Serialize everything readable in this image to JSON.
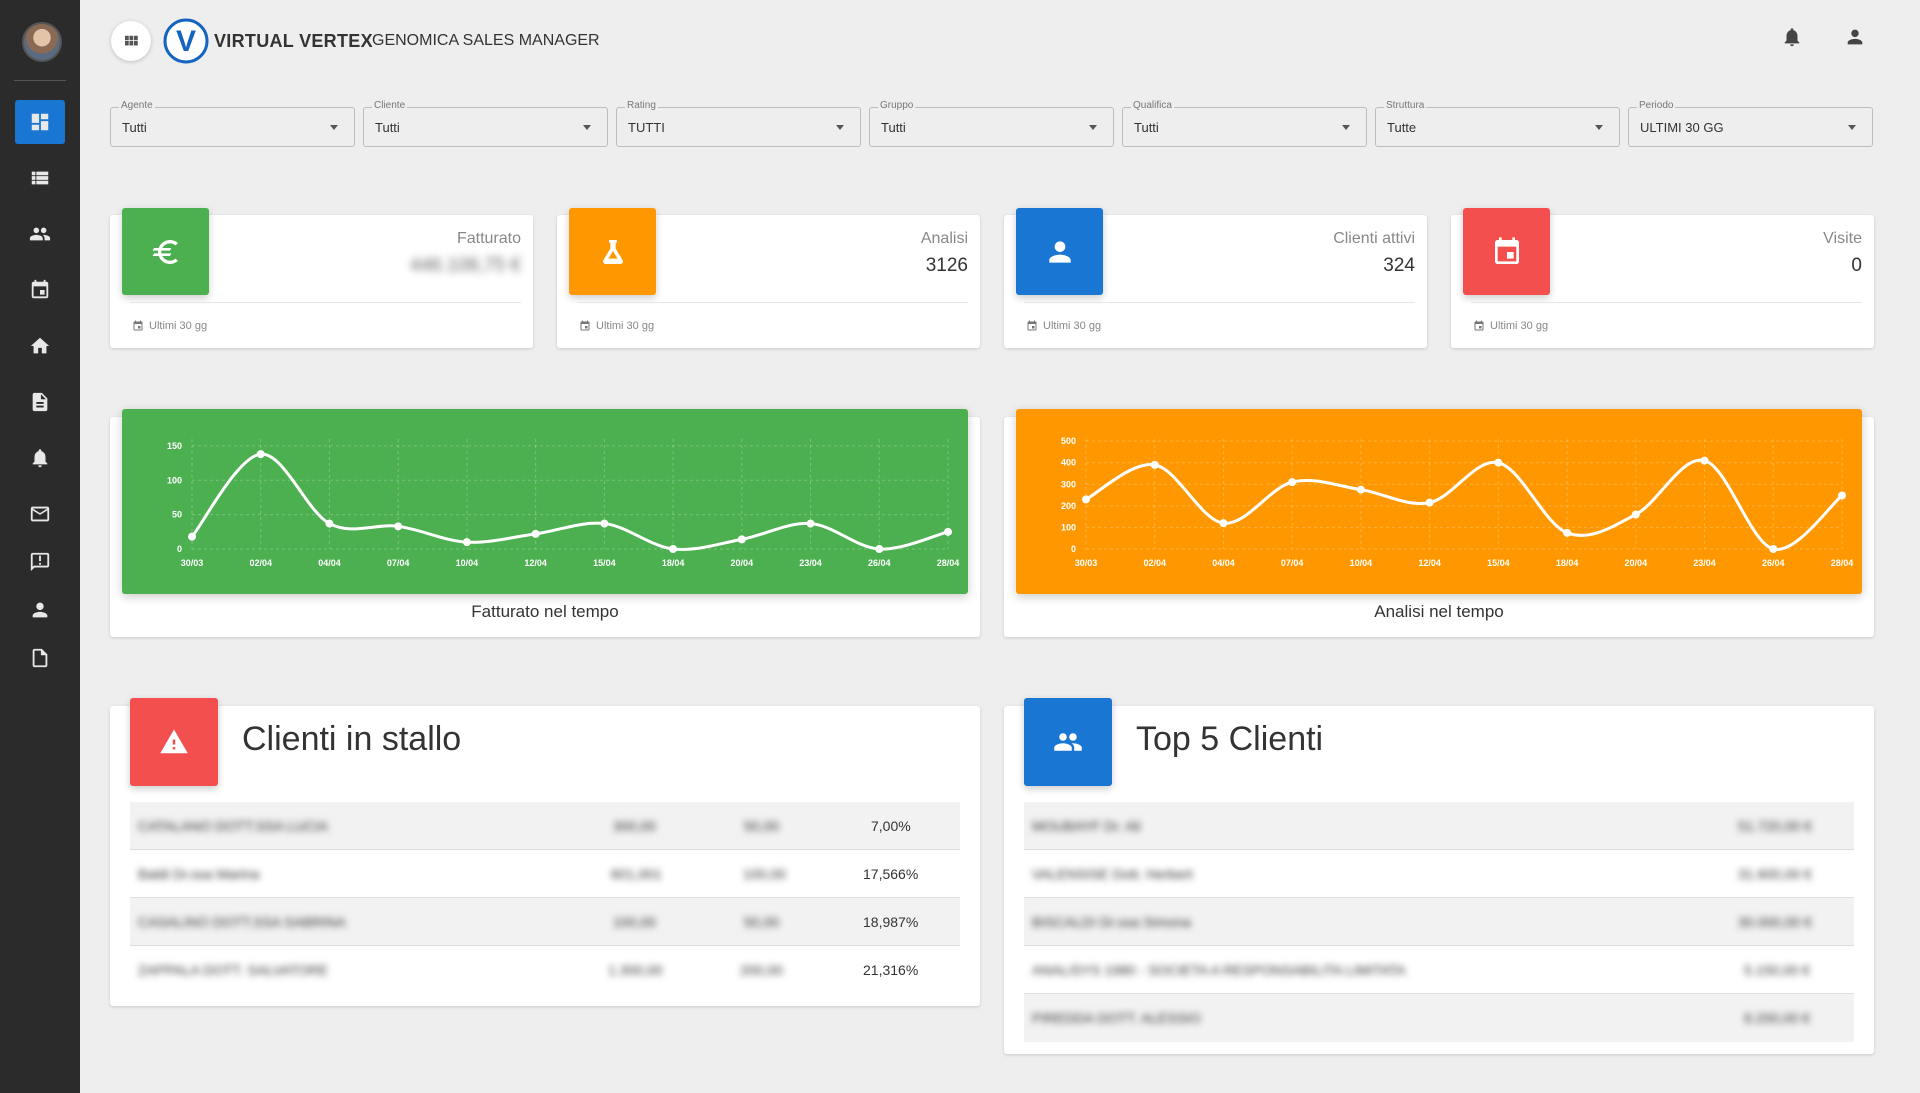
{
  "header": {
    "brand": "VIRTUAL VERTEX",
    "app_title": "GENOMICA SALES MANAGER",
    "logo_letter": "V"
  },
  "sidebar": {
    "items": [
      {
        "name": "dashboard",
        "icon": "dashboard-icon",
        "active": true
      },
      {
        "name": "list",
        "icon": "list-icon"
      },
      {
        "name": "clients",
        "icon": "people-icon"
      },
      {
        "name": "calendar",
        "icon": "calendar-icon"
      },
      {
        "name": "home",
        "icon": "home-icon"
      },
      {
        "name": "documents",
        "icon": "document-icon"
      },
      {
        "name": "notifications",
        "icon": "bell-icon"
      },
      {
        "name": "mail",
        "icon": "mail-icon"
      },
      {
        "name": "feedback",
        "icon": "feedback-icon"
      },
      {
        "name": "user",
        "icon": "person-icon"
      },
      {
        "name": "file",
        "icon": "file-icon"
      }
    ]
  },
  "filters": [
    {
      "label": "Agente",
      "value": "Tutti"
    },
    {
      "label": "Cliente",
      "value": "Tutti"
    },
    {
      "label": "Rating",
      "value": "TUTTI"
    },
    {
      "label": "Gruppo",
      "value": "Tutti"
    },
    {
      "label": "Qualifica",
      "value": "Tutti"
    },
    {
      "label": "Struttura",
      "value": "Tutte"
    },
    {
      "label": "Periodo",
      "value": "ULTIMI 30 GG"
    }
  ],
  "stats": [
    {
      "label": "Fatturato",
      "value": "446.108,75 €",
      "footer": "Ultimi 30 gg",
      "color": "#4caf50",
      "icon": "euro-icon"
    },
    {
      "label": "Analisi",
      "value": "3126",
      "footer": "Ultimi 30 gg",
      "color": "#ff9800",
      "icon": "flask-icon"
    },
    {
      "label": "Clienti attivi",
      "value": "324",
      "footer": "Ultimi 30 gg",
      "color": "#1976d2",
      "icon": "person-icon"
    },
    {
      "label": "Visite",
      "value": "0",
      "footer": "Ultimi 30 gg",
      "color": "#f44f4f",
      "icon": "calendar-icon"
    }
  ],
  "chart_data": [
    {
      "type": "line",
      "title": "Fatturato nel tempo",
      "color": "#4caf50",
      "categories": [
        "30/03",
        "02/04",
        "04/04",
        "07/04",
        "10/04",
        "12/04",
        "15/04",
        "18/04",
        "20/04",
        "23/04",
        "26/04",
        "28/04"
      ],
      "values": [
        18,
        138,
        37,
        33,
        10,
        22,
        37,
        0,
        14,
        37,
        0,
        25
      ],
      "yticks": [
        0,
        50,
        100,
        150
      ],
      "ylim": [
        0,
        160
      ],
      "grid": true
    },
    {
      "type": "line",
      "title": "Analisi nel tempo",
      "color": "#ff9800",
      "categories": [
        "30/03",
        "02/04",
        "04/04",
        "07/04",
        "10/04",
        "12/04",
        "15/04",
        "18/04",
        "20/04",
        "23/04",
        "26/04",
        "28/04"
      ],
      "values": [
        230,
        390,
        120,
        310,
        275,
        215,
        400,
        75,
        160,
        410,
        0,
        248
      ],
      "yticks": [
        0,
        100,
        200,
        300,
        400,
        500
      ],
      "ylim": [
        0,
        510
      ],
      "grid": true
    }
  ],
  "stalled": {
    "title": "Clienti in stallo",
    "color": "#f44f4f",
    "rows": [
      {
        "name": "CATALANO DOTT.SSA LUCIA",
        "a": "300,00",
        "b": "50,00",
        "pct": "7,00%"
      },
      {
        "name": "Baldi Dr.ssa Marina",
        "a": "601,001",
        "b": "100,00",
        "pct": "17,566%"
      },
      {
        "name": "CASALINO DOTT.SSA SABRINA",
        "a": "100,00",
        "b": "50,00",
        "pct": "18,987%"
      },
      {
        "name": "ZAPPALA DOTT. SALVATORE",
        "a": "1.300,00",
        "b": "200,00",
        "pct": "21,316%"
      }
    ]
  },
  "top5": {
    "title": "Top 5 Clienti",
    "color": "#1976d2",
    "rows": [
      {
        "name": "MOUBAYF Dr. Ali",
        "value": "51.720,00 €"
      },
      {
        "name": "VALENSISE Dott. Herbert",
        "value": "31.600,00 €"
      },
      {
        "name": "BISCALDI Dr.ssa Simona",
        "value": "30.000,00 €"
      },
      {
        "name": "ANALISYS 1980 - SOCIETA A RESPONSABILITA LIMITATA",
        "value": "5.150,00 €"
      },
      {
        "name": "PIREDDA DOTT. ALESSIO",
        "value": "8.200,00 €"
      }
    ]
  }
}
